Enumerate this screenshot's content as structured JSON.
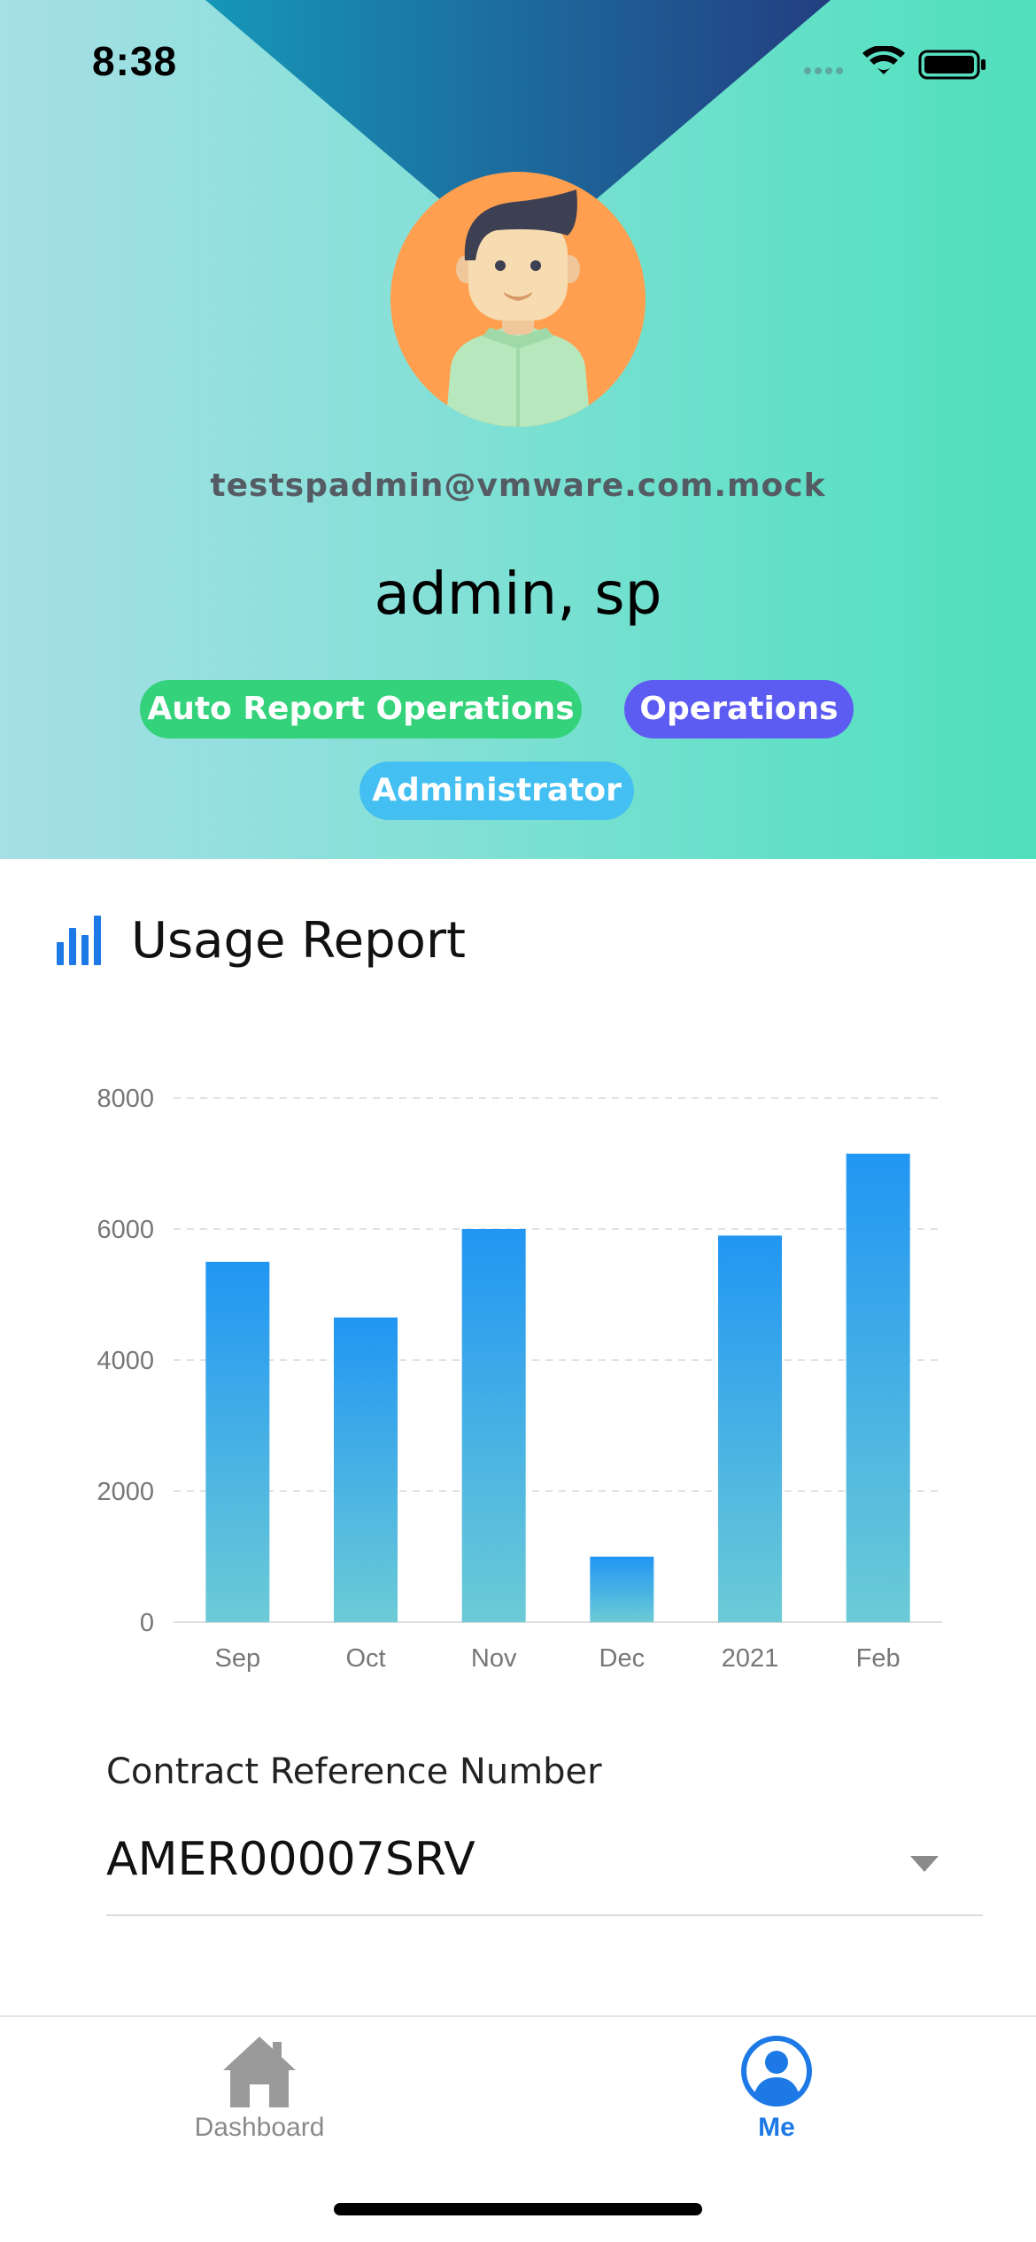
{
  "status_bar": {
    "time": "8:38"
  },
  "profile": {
    "email": "testspadmin@vmware.com.mock",
    "name": "admin, sp",
    "roles": [
      "Auto Report Operations",
      "Operations",
      "Administrator"
    ]
  },
  "colors": {
    "accent": "#1d79e6",
    "role_green": "#34d27a",
    "role_purple": "#5d5cf2",
    "role_blue": "#43bff2",
    "avatar_bg": "#ff9f4f"
  },
  "usage_report": {
    "title": "Usage Report",
    "icon": "bar-chart-icon"
  },
  "chart_data": {
    "type": "bar",
    "title": "",
    "xlabel": "",
    "ylabel": "",
    "categories": [
      "Sep",
      "Oct",
      "Nov",
      "Dec",
      "2021",
      "Feb"
    ],
    "values": [
      5500,
      4650,
      6000,
      1000,
      5900,
      7150
    ],
    "ylim": [
      0,
      8000
    ],
    "yticks": [
      0,
      2000,
      4000,
      6000,
      8000
    ],
    "grid": true,
    "bar_color_top": "#2196f3",
    "bar_color_bottom": "#6ccbd6"
  },
  "contract": {
    "label": "Contract Reference Number",
    "selected": "AMER00007SRV"
  },
  "tabbar": {
    "tabs": [
      {
        "label": "Dashboard",
        "icon": "home-icon",
        "active": false
      },
      {
        "label": "Me",
        "icon": "user-circle-icon",
        "active": true
      }
    ]
  }
}
